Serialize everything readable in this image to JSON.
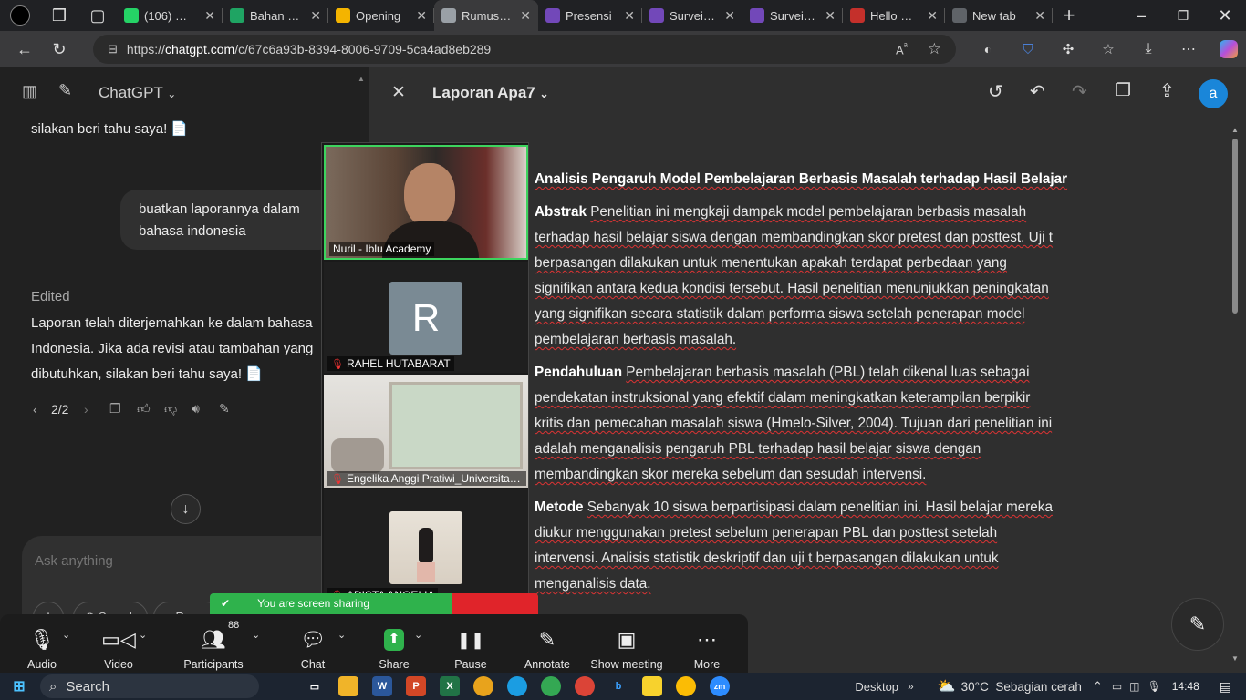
{
  "browser": {
    "tabs": [
      {
        "label": "(106) Wha",
        "color": "#25d366"
      },
      {
        "label": "Bahan Ge",
        "color": "#1fa463"
      },
      {
        "label": "Opening",
        "color": "#f4b400"
      },
      {
        "label": "Rumus IF",
        "color": "#9aa0a6",
        "active": true
      },
      {
        "label": "Presensi",
        "color": "#7248b9"
      },
      {
        "label": "Survei Ke",
        "color": "#7248b9"
      },
      {
        "label": "Survei Ge",
        "color": "#7248b9"
      },
      {
        "label": "Hello Goo",
        "color": "#c4302b"
      },
      {
        "label": "New tab",
        "color": "#5f6368"
      }
    ],
    "url_prefix": "https://",
    "url_domain": "chatgpt.com",
    "url_path": "/c/67c6a93b-8394-8006-9709-5ca4ad8eb289"
  },
  "sidebar": {
    "model_label": "ChatGPT",
    "msg_prev_tail": "silakan beri tahu saya! 📄",
    "user_message": "buatkan laporannya dalam bahasa indonesia",
    "edited_label": "Edited",
    "assistant_reply": "Laporan telah diterjemahkan ke dalam bahasa Indonesia. Jika ada revisi atau tambahan yang dibutuhkan, silakan beri tahu saya! 📄",
    "pager": "2/2",
    "input_placeholder": "Ask anything",
    "tool_search": "Search",
    "tool_reason": "Reaso"
  },
  "canvas": {
    "title": "Laporan Apa7",
    "avatar_letter": "a",
    "heading": "Analisis Pengaruh Model Pembelajaran Berbasis Masalah terhadap Hasil Belajar",
    "abstrak_label": "Abstrak",
    "abstrak_text": "Penelitian ini mengkaji dampak model pembelajaran berbasis masalah terhadap hasil belajar siswa dengan membandingkan skor pretest dan posttest. Uji t berpasangan dilakukan untuk menentukan apakah terdapat perbedaan yang signifikan antara kedua kondisi tersebut. Hasil penelitian menunjukkan peningkatan yang signifikan secara statistik dalam performa siswa setelah penerapan model pembelajaran berbasis masalah.",
    "pendahuluan_label": "Pendahuluan",
    "pendahuluan_text": "Pembelajaran berbasis masalah (PBL) telah dikenal luas sebagai pendekatan instruksional yang efektif dalam meningkatkan keterampilan berpikir kritis dan pemecahan masalah siswa (Hmelo-Silver, 2004). Tujuan dari penelitian ini adalah menganalisis pengaruh PBL terhadap hasil belajar siswa dengan membandingkan skor mereka sebelum dan sesudah intervensi.",
    "metode_label": "Metode",
    "metode_text": "Sebanyak 10 siswa berpartisipasi dalam penelitian ini. Hasil belajar mereka diukur menggunakan pretest sebelum penerapan PBL dan posttest setelah intervensi. Analisis statistik deskriptif dan uji t berpasangan dilakukan untuk menganalisis data."
  },
  "zoom": {
    "participants": [
      {
        "name": "Nuril - Iblu Academy"
      },
      {
        "name": "RAHEL HUTABARAT",
        "initial": "R"
      },
      {
        "name": "Engelika Anggi Pratiwi_Universitas..."
      },
      {
        "name": "ADISTA ANGELIA"
      }
    ],
    "sharing_banner": "You are screen sharing",
    "participant_count": "88",
    "toolbar": [
      {
        "label": "Audio",
        "icon": "🎙"
      },
      {
        "label": "Video",
        "icon": "▭"
      },
      {
        "label": "Participants",
        "icon": "👥"
      },
      {
        "label": "Chat",
        "icon": "💬"
      },
      {
        "label": "Share",
        "icon": "⬆"
      },
      {
        "label": "Pause",
        "icon": "❚❚"
      },
      {
        "label": "Annotate",
        "icon": "✎"
      },
      {
        "label": "Show meeting",
        "icon": "▣"
      },
      {
        "label": "More",
        "icon": "⋯"
      }
    ]
  },
  "taskbar": {
    "search_label": "Search",
    "desktop_label": "Desktop",
    "weather": "30°C  Sebagian cerah",
    "time": "14:48"
  }
}
